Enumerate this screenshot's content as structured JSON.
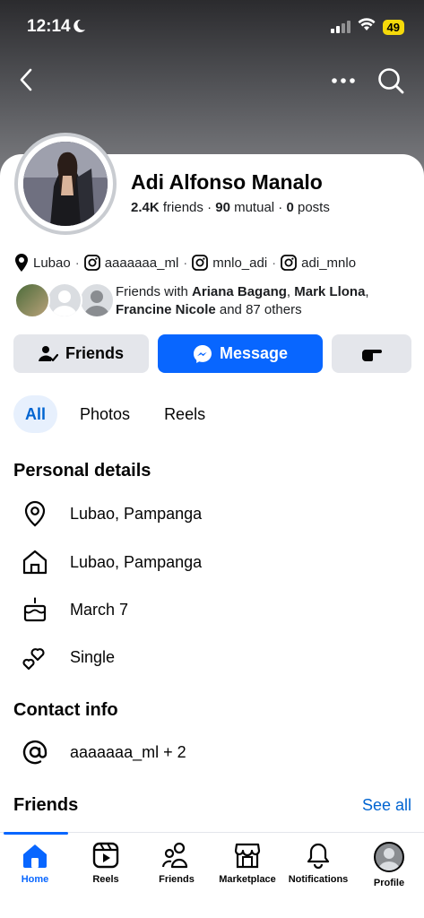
{
  "status_bar": {
    "time": "12:14",
    "battery": "49"
  },
  "profile": {
    "name": "Adi Alfonso Manalo",
    "friends_count": "2.4K",
    "friends_label": "friends",
    "mutual_count": "90",
    "mutual_label": "mutual",
    "posts_count": "0",
    "posts_label": "posts"
  },
  "info_row": {
    "location": "Lubao",
    "instagram_1": "aaaaaaa_ml",
    "instagram_2": "mnlo_adi",
    "instagram_3": "adi_mnlo"
  },
  "mutual_friends": {
    "prefix": "Friends with",
    "name_1": "Ariana Bagang",
    "name_2": "Mark Llona",
    "name_3": "Francine Nicole",
    "suffix": "and 87 others"
  },
  "actions": {
    "friends_label": "Friends",
    "message_label": "Message"
  },
  "tabs": [
    {
      "label": "All"
    },
    {
      "label": "Photos"
    },
    {
      "label": "Reels"
    }
  ],
  "personal_details": {
    "title": "Personal details",
    "items": [
      {
        "icon": "location-pin-icon",
        "text": "Lubao, Pampanga"
      },
      {
        "icon": "home-icon",
        "text": "Lubao, Pampanga"
      },
      {
        "icon": "birthday-cake-icon",
        "text": "March 7"
      },
      {
        "icon": "hearts-icon",
        "text": "Single"
      }
    ]
  },
  "contact_info": {
    "title": "Contact info",
    "items": [
      {
        "icon": "at-sign-icon",
        "text": "aaaaaaa_ml + 2"
      }
    ]
  },
  "friends_section": {
    "title": "Friends",
    "see_all": "See all"
  },
  "bottom_nav": [
    {
      "label": "Home",
      "active": true
    },
    {
      "label": "Reels"
    },
    {
      "label": "Friends"
    },
    {
      "label": "Marketplace"
    },
    {
      "label": "Notifications"
    },
    {
      "label": "Profile"
    }
  ],
  "colors": {
    "accent": "#0866ff",
    "link": "#0064d1",
    "button_gray": "#e4e6eb"
  }
}
